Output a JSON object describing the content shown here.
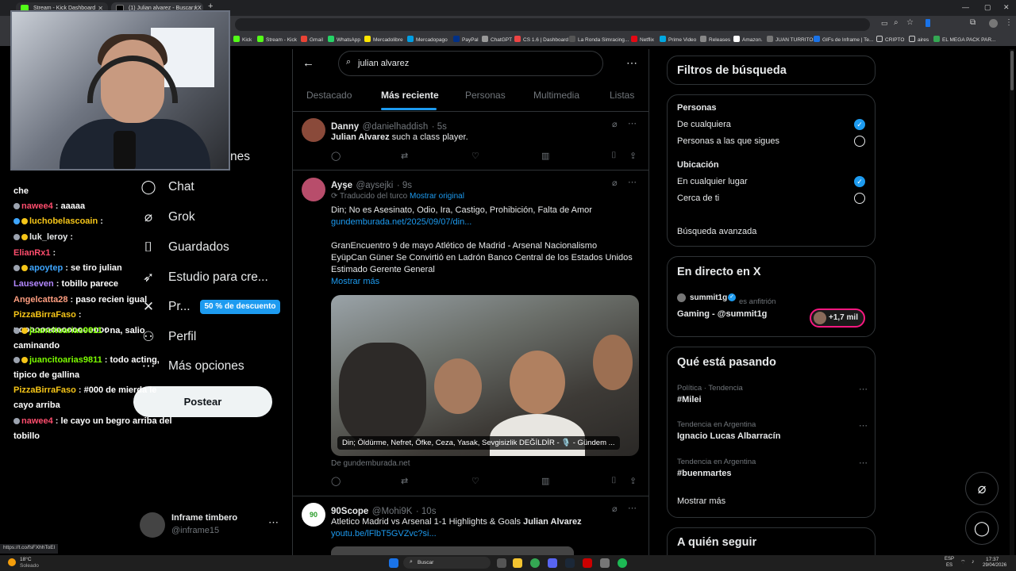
{
  "browser": {
    "tabs": [
      {
        "title": "Stream - Kick Dashboard",
        "active": false
      },
      {
        "title": "(1) Julian alvarez - Buscar / X",
        "active": true
      }
    ],
    "new_tab": "+",
    "bookmarks": [
      "Kick",
      "Stream - Kick",
      "Gmail",
      "WhatsApp",
      "Mercadolibre",
      "Mercadopago",
      "PayPal",
      "ChatGPT",
      "CS 1.6 | Dashboard",
      "La Ronda Simracing...",
      "Netflix",
      "Prime Video",
      "Releases",
      "Amazon.",
      "JUAN TURRITO",
      "GIFs de Inframe | Te...",
      "CRIPTO",
      "aires",
      "EL MEGA PACK PAR..."
    ],
    "status_url": "https://t.co/fsFXhhToEl"
  },
  "chat": [
    {
      "user": "",
      "msg": "che",
      "color": "#ffffff"
    },
    {
      "user": "nawee4",
      "msg": "aaaaa",
      "color": "#ff4d6d"
    },
    {
      "user": "luchobelascoain",
      "msg": "",
      "color": "#f5c518"
    },
    {
      "user": "luk_leroy",
      "msg": "",
      "color": "#e7e9ea"
    },
    {
      "user": "ElianRx1",
      "msg": "",
      "color": "#ff4d6d"
    },
    {
      "user": "apoytep",
      "msg": "se tiro julian",
      "color": "#3ea6ff"
    },
    {
      "user": "Lauseven",
      "msg": "tobillo parece",
      "color": "#b388ff"
    },
    {
      "user": "Angelcatta28",
      "msg": "paso recien igual",
      "color": "#ff9e80"
    },
    {
      "user": "PizzaBirraFaso",
      "msg": "nooooooooooooooooo",
      "color": "#f5c518"
    },
    {
      "user": "juancitoarias9811",
      "msg": "na, salio caminando",
      "color": "#7cfc00"
    },
    {
      "user": "juancitoarias9811",
      "msg": "todo acting, tipico de gallina",
      "color": "#7cfc00"
    },
    {
      "user": "PizzaBirraFaso",
      "msg": "#000 de mierda le cayo arriba",
      "color": "#f5c518"
    },
    {
      "user": "nawee4",
      "msg": "le cayo un begro arriba del tobillo",
      "color": "#ff4d6d"
    }
  ],
  "nav": {
    "partial_top": "nes",
    "items": [
      {
        "label": "Chat",
        "icon": "chat-icon"
      },
      {
        "label": "Grok",
        "icon": "grok-icon"
      },
      {
        "label": "Guardados",
        "icon": "bookmark-icon"
      },
      {
        "label": "Estudio para cre...",
        "icon": "rocket-icon"
      },
      {
        "label": "Pr...",
        "icon": "x-logo-icon"
      },
      {
        "label": "Perfil",
        "icon": "person-icon"
      },
      {
        "label": "Más opciones",
        "icon": "more-circle-icon"
      }
    ],
    "premium_badge": "50 % de descuento",
    "post_button": "Postear",
    "account": {
      "name": "Inframe timbero",
      "handle": "@inframe15"
    }
  },
  "search": {
    "query": "julian alvarez",
    "tabs": [
      "Destacado",
      "Más reciente",
      "Personas",
      "Multimedia",
      "Listas"
    ],
    "active_tab": "Más reciente"
  },
  "tweets": [
    {
      "name": "Danny",
      "handle": "@danielhaddish",
      "time": "· 5s",
      "bold": "Julian Alvarez",
      "text": " such a class player."
    },
    {
      "name": "Ayşe",
      "handle": "@aysejki",
      "time": "· 9s",
      "translated": "Traducido del turco",
      "show_original": "Mostrar original",
      "line1": "Din; No es Asesinato, Odio, Ira, Castigo, Prohibición, Falta de Amor",
      "link": "gundemburada.net/2025/09/07/din...",
      "line2": "GranEncuentro 9 de mayo Atlético de Madrid - Arsenal Nacionalismo EyüpCan Güner Se Convirtió en Ladrón Banco Central de los Estados Unidos Estimado Gerente General",
      "show_more": "Mostrar más",
      "image_caption": "Din; Öldürme, Nefret, Öfke, Ceza, Yasak, Sevgisizlik DEĞİLDİR - 🎙️ - Gündem ...",
      "source": "De gundemburada.net"
    },
    {
      "name": "90Scope",
      "handle": "@Mohi9K",
      "time": "· 10s",
      "text": "Atletico Madrid vs Arsenal 1-1 Highlights & Goals ",
      "bold": "Julian Alvarez",
      "link": "youtu.be/lFlbT5GVZvc?si..."
    }
  ],
  "filters": {
    "title": "Filtros de búsqueda",
    "people_heading": "Personas",
    "people_options": [
      "De cualquiera",
      "Personas a las que sigues"
    ],
    "location_heading": "Ubicación",
    "location_options": [
      "En cualquier lugar",
      "Cerca de ti"
    ],
    "advanced": "Búsqueda avanzada"
  },
  "live": {
    "title": "En directo en X",
    "host": "summit1g",
    "host_label": "es anfitrión",
    "space": "Gaming - @summit1g",
    "listeners": "+1,7 mil"
  },
  "trending": {
    "title": "Qué está pasando",
    "items": [
      {
        "context": "Política · Tendencia",
        "topic": "#Milei"
      },
      {
        "context": "Tendencia en Argentina",
        "topic": "Ignacio Lucas Albarracín"
      },
      {
        "context": "Tendencia en Argentina",
        "topic": "#buenmartes"
      }
    ],
    "show_more": "Mostrar más"
  },
  "who_to_follow": "A quién seguir",
  "taskbar": {
    "weather_temp": "18°C",
    "weather_desc": "Soleado",
    "search": "Buscar",
    "lang": "ESP",
    "lang2": "ES",
    "time": "17:37",
    "date": "29/04/2026"
  },
  "colors": {
    "accent": "#1d9bf0",
    "background": "#000000",
    "border": "#2f3336"
  }
}
